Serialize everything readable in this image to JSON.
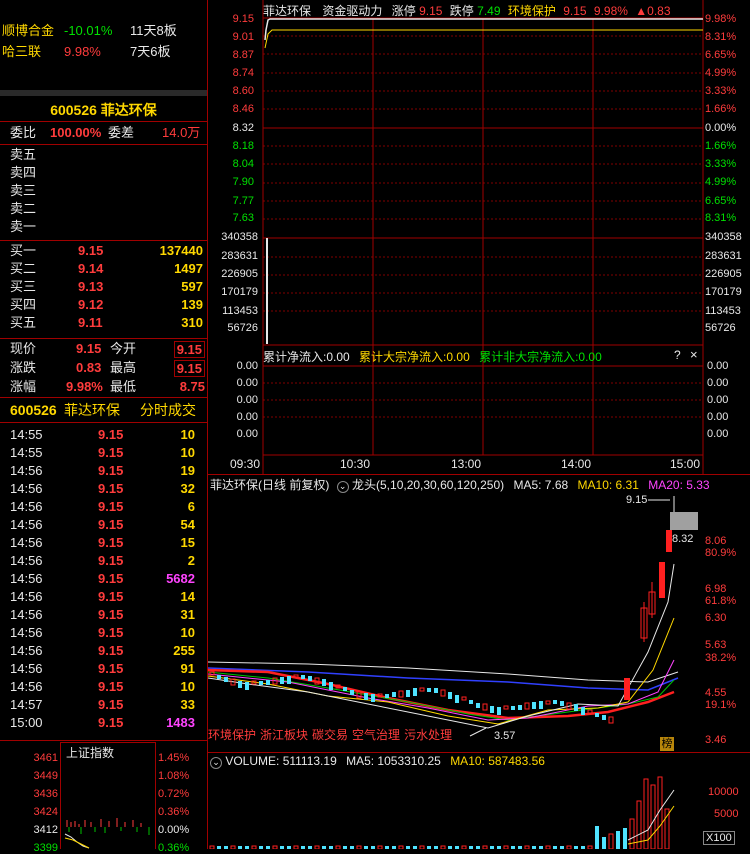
{
  "top_list": [
    {
      "name": "顺博合金",
      "pct": "-10.01%",
      "days": "11天8板"
    },
    {
      "name": "哈三联",
      "pct": "9.98%",
      "days": "7天6板"
    }
  ],
  "quote": {
    "code_name": "600526  菲达环保",
    "weibi_label": "委比",
    "weibi_val": "100.00%",
    "weicha_label": "委差",
    "weicha_val": "14.0万",
    "sells": [
      "卖五",
      "卖四",
      "卖三",
      "卖二",
      "卖一"
    ],
    "buys": [
      {
        "label": "买一",
        "price": "9.15",
        "vol": "137440"
      },
      {
        "label": "买二",
        "price": "9.14",
        "vol": "1497"
      },
      {
        "label": "买三",
        "price": "9.13",
        "vol": "597"
      },
      {
        "label": "买四",
        "price": "9.12",
        "vol": "139"
      },
      {
        "label": "买五",
        "price": "9.11",
        "vol": "310"
      }
    ],
    "stats": [
      {
        "l1": "现价",
        "v1": "9.15",
        "l2": "今开",
        "v2": "9.15"
      },
      {
        "l1": "涨跌",
        "v1": "0.83",
        "l2": "最高",
        "v2": "9.15"
      },
      {
        "l1": "涨幅",
        "v1": "9.98%",
        "l2": "最低",
        "v2": "8.75"
      }
    ]
  },
  "ticks": {
    "header_code": "600526",
    "header_name": "菲达环保",
    "header_tab": "分时成交",
    "rows": [
      {
        "t": "14:55",
        "p": "9.15",
        "v": "10",
        "c": "yellow"
      },
      {
        "t": "14:55",
        "p": "9.15",
        "v": "10",
        "c": "yellow"
      },
      {
        "t": "14:56",
        "p": "9.15",
        "v": "19",
        "c": "yellow"
      },
      {
        "t": "14:56",
        "p": "9.15",
        "v": "32",
        "c": "yellow"
      },
      {
        "t": "14:56",
        "p": "9.15",
        "v": "6",
        "c": "yellow"
      },
      {
        "t": "14:56",
        "p": "9.15",
        "v": "54",
        "c": "yellow"
      },
      {
        "t": "14:56",
        "p": "9.15",
        "v": "15",
        "c": "yellow"
      },
      {
        "t": "14:56",
        "p": "9.15",
        "v": "2",
        "c": "yellow"
      },
      {
        "t": "14:56",
        "p": "9.15",
        "v": "5682",
        "c": "magenta"
      },
      {
        "t": "14:56",
        "p": "9.15",
        "v": "14",
        "c": "yellow"
      },
      {
        "t": "14:56",
        "p": "9.15",
        "v": "31",
        "c": "yellow"
      },
      {
        "t": "14:56",
        "p": "9.15",
        "v": "10",
        "c": "yellow"
      },
      {
        "t": "14:56",
        "p": "9.15",
        "v": "255",
        "c": "yellow"
      },
      {
        "t": "14:56",
        "p": "9.15",
        "v": "91",
        "c": "yellow"
      },
      {
        "t": "14:56",
        "p": "9.15",
        "v": "10",
        "c": "yellow"
      },
      {
        "t": "14:57",
        "p": "9.15",
        "v": "33",
        "c": "yellow"
      },
      {
        "t": "15:00",
        "p": "9.15",
        "v": "1483",
        "c": "magenta"
      }
    ]
  },
  "mini_index": {
    "title": "上证指数",
    "left_ticks": [
      "3461",
      "3449",
      "3436",
      "3424",
      "3412",
      "3399"
    ],
    "right_ticks": [
      "1.45%",
      "1.08%",
      "0.72%",
      "0.36%",
      "0.00%",
      "0.36%"
    ]
  },
  "intraday": {
    "title": "菲达环保",
    "subtitle": "资金驱动力",
    "limit_up_label": "涨停",
    "limit_up": "9.15",
    "limit_down_label": "跌停",
    "limit_down": "7.49",
    "sector": "环境保护",
    "price": "9.15",
    "pct": "9.98%",
    "chg": "▲0.83",
    "left_axis": [
      "9.15",
      "9.01",
      "8.87",
      "8.74",
      "8.60",
      "8.46",
      "8.32",
      "8.18",
      "8.04",
      "7.90",
      "7.77",
      "7.63"
    ],
    "right_axis": [
      "9.98%",
      "8.31%",
      "6.65%",
      "4.99%",
      "3.33%",
      "1.66%",
      "0.00%",
      "1.66%",
      "3.33%",
      "4.99%",
      "6.65%",
      "8.31%"
    ],
    "vol_axis": [
      "340358",
      "283631",
      "226905",
      "170179",
      "113453",
      "56726"
    ],
    "flow_label_1": "累计净流入:0.00",
    "flow_label_2": "累计大宗净流入:0.00",
    "flow_label_3": "累计非大宗净流入:0.00",
    "flow_axis": [
      "0.00",
      "0.00",
      "0.00",
      "0.00",
      "0.00"
    ],
    "times": [
      "09:30",
      "10:30",
      "13:00",
      "14:00",
      "15:00"
    ]
  },
  "kline": {
    "title": "菲达环保(日线 前复权)",
    "indicator": "龙头(5,10,20,30,60,120,250)",
    "ma5": "MA5: 7.68",
    "ma10": "MA10: 6.31",
    "ma20": "MA20: 5.33",
    "high_label": "9.15",
    "low_label": "3.57",
    "price_label": "8.32",
    "right_axis": [
      {
        "v": "8.06",
        "c": "red"
      },
      {
        "v": "80.9%",
        "c": "red"
      },
      {
        "v": "6.98",
        "c": "red"
      },
      {
        "v": "61.8%",
        "c": "red"
      },
      {
        "v": "6.30",
        "c": "red"
      },
      {
        "v": "5.63",
        "c": "red"
      },
      {
        "v": "38.2%",
        "c": "red"
      },
      {
        "v": "4.55",
        "c": "red"
      },
      {
        "v": "19.1%",
        "c": "red"
      },
      {
        "v": "3.46",
        "c": "red"
      }
    ],
    "tags": [
      "环境保护",
      "浙江板块",
      "碳交易",
      "空气治理",
      "污水处理"
    ],
    "badge": "榜"
  },
  "volume": {
    "label": "VOLUME: 511113.19",
    "ma5": "MA5: 1053310.25",
    "ma10": "MA10: 587483.56",
    "axis_10000": "10000",
    "axis_5000": "5000",
    "unit": "X100"
  }
}
